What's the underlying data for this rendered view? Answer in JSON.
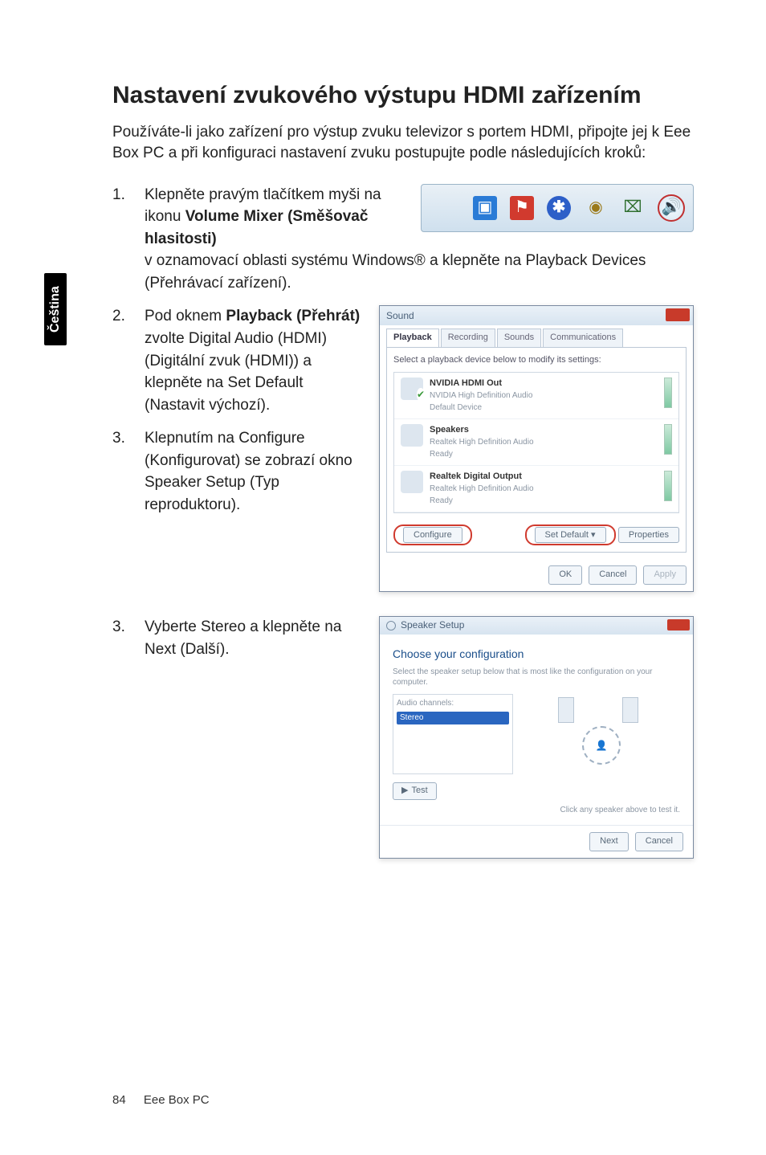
{
  "language_tab": "Čeština",
  "heading": "Nastavení zvukového výstupu HDMI zařízením",
  "intro": "Používáte-li jako zařízení pro výstup zvuku televizor s portem HDMI, připojte jej k Eee Box PC a při konfiguraci nastavení zvuku postupujte podle následujících kroků:",
  "steps": {
    "s1_a": "Klepněte pravým tlačítkem myši na ikonu ",
    "s1_b_bold": "Volume Mixer (Směšovač hlasitosti)",
    "s1_c": " v oznamovací oblasti systému Windows® a klepněte na Playback Devices (Přehrávací zařízení).",
    "s2_a": "Pod oknem ",
    "s2_b_bold": "Playback (Přehrát)",
    "s2_c": " zvolte Digital Audio (HDMI) (Digitální zvuk (HDMI)) a klepněte na Set Default (Nastavit výchozí).",
    "s3": "Klepnutím na Configure (Konfigurovat) se zobrazí okno Speaker Setup (Typ reproduktoru).",
    "s4": "Vyberte Stereo a klepněte na Next (Další)."
  },
  "tray_icons": {
    "blue": "▣",
    "red_flag": "⚑",
    "bluetooth": "✱",
    "globe": "◉",
    "battery": "⌧",
    "volume": "🔊"
  },
  "sound_dialog": {
    "title": "Sound",
    "tabs": [
      "Playback",
      "Recording",
      "Sounds",
      "Communications"
    ],
    "hint": "Select a playback device below to modify its settings:",
    "devices": [
      {
        "name": "NVIDIA HDMI Out",
        "sub": "NVIDIA High Definition Audio",
        "status": "Default Device",
        "checked": true
      },
      {
        "name": "Speakers",
        "sub": "Realtek High Definition Audio",
        "status": "Ready",
        "checked": false
      },
      {
        "name": "Realtek Digital Output",
        "sub": "Realtek High Definition Audio",
        "status": "Ready",
        "checked": false
      }
    ],
    "buttons": {
      "configure": "Configure",
      "set_default": "Set Default",
      "properties": "Properties",
      "ok": "OK",
      "cancel": "Cancel",
      "apply": "Apply"
    }
  },
  "wizard": {
    "title": "Speaker Setup",
    "heading": "Choose your configuration",
    "sub": "Select the speaker setup below that is most like the configuration on your computer.",
    "list_label": "Audio channels:",
    "list_selected": "Stereo",
    "test": "Test",
    "click_hint": "Click any speaker above to test it.",
    "next": "Next",
    "cancel": "Cancel"
  },
  "footer": {
    "page_number": "84",
    "product": "Eee Box PC"
  }
}
